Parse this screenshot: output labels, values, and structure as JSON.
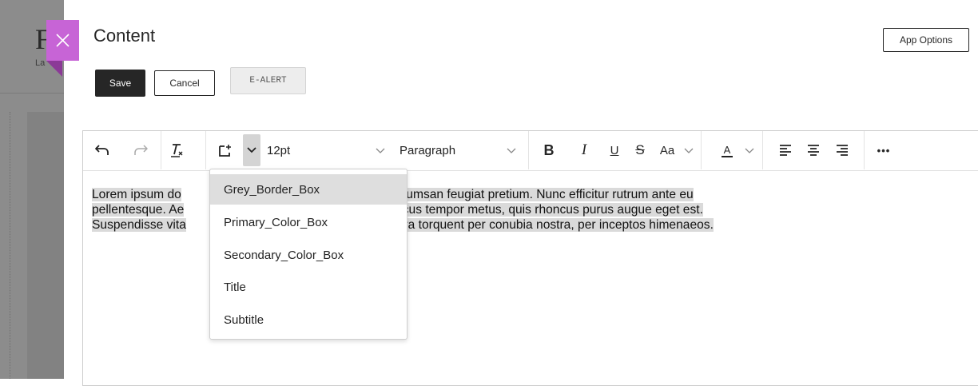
{
  "background_page": {
    "title_fragment": "F",
    "subtitle_fragment": "La"
  },
  "panel": {
    "title": "Content",
    "app_options_label": "App Options",
    "save_label": "Save",
    "cancel_label": "Cancel",
    "ealert_label": "E-ALERT"
  },
  "toolbar": {
    "undo_icon": "undo-icon",
    "redo_icon": "redo-icon",
    "clear_format_icon": "clear-formatting-icon",
    "custom_style_icon": "custom-style-icon",
    "font_size": "12pt",
    "block_format": "Paragraph",
    "bold_label": "B",
    "italic_label": "I",
    "underline_label": "U",
    "strike_label": "S",
    "case_label": "Aa",
    "text_color_label": "A",
    "more_label": "•••"
  },
  "content": {
    "line1_a": "Lorem ipsum do",
    "line1_b": "piscing elit. Proin accumsan feugiat pretium. Nunc efficitur rutrum ante eu",
    "line2_a": "pellentesque. Ae",
    "line2_b": "is faucibus, ipsum lacus tempor metus, quis rhoncus purus augue eget est.",
    "line3_a": "Suspendisse vita",
    "line3_b": "aciti sociosqu ad litora torquent per conubia nostra, per inceptos himenaeos."
  },
  "style_dropdown": {
    "items": [
      {
        "label": "Grey_Border_Box",
        "active": true
      },
      {
        "label": "Primary_Color_Box",
        "active": false
      },
      {
        "label": "Secondary_Color_Box",
        "active": false
      },
      {
        "label": "Title",
        "active": false
      },
      {
        "label": "Subtitle",
        "active": false
      }
    ]
  },
  "colors": {
    "close_button": "#c764d6",
    "dark_button": "#262626",
    "highlight": "#dadada",
    "overlay": "#8c8c8c"
  }
}
